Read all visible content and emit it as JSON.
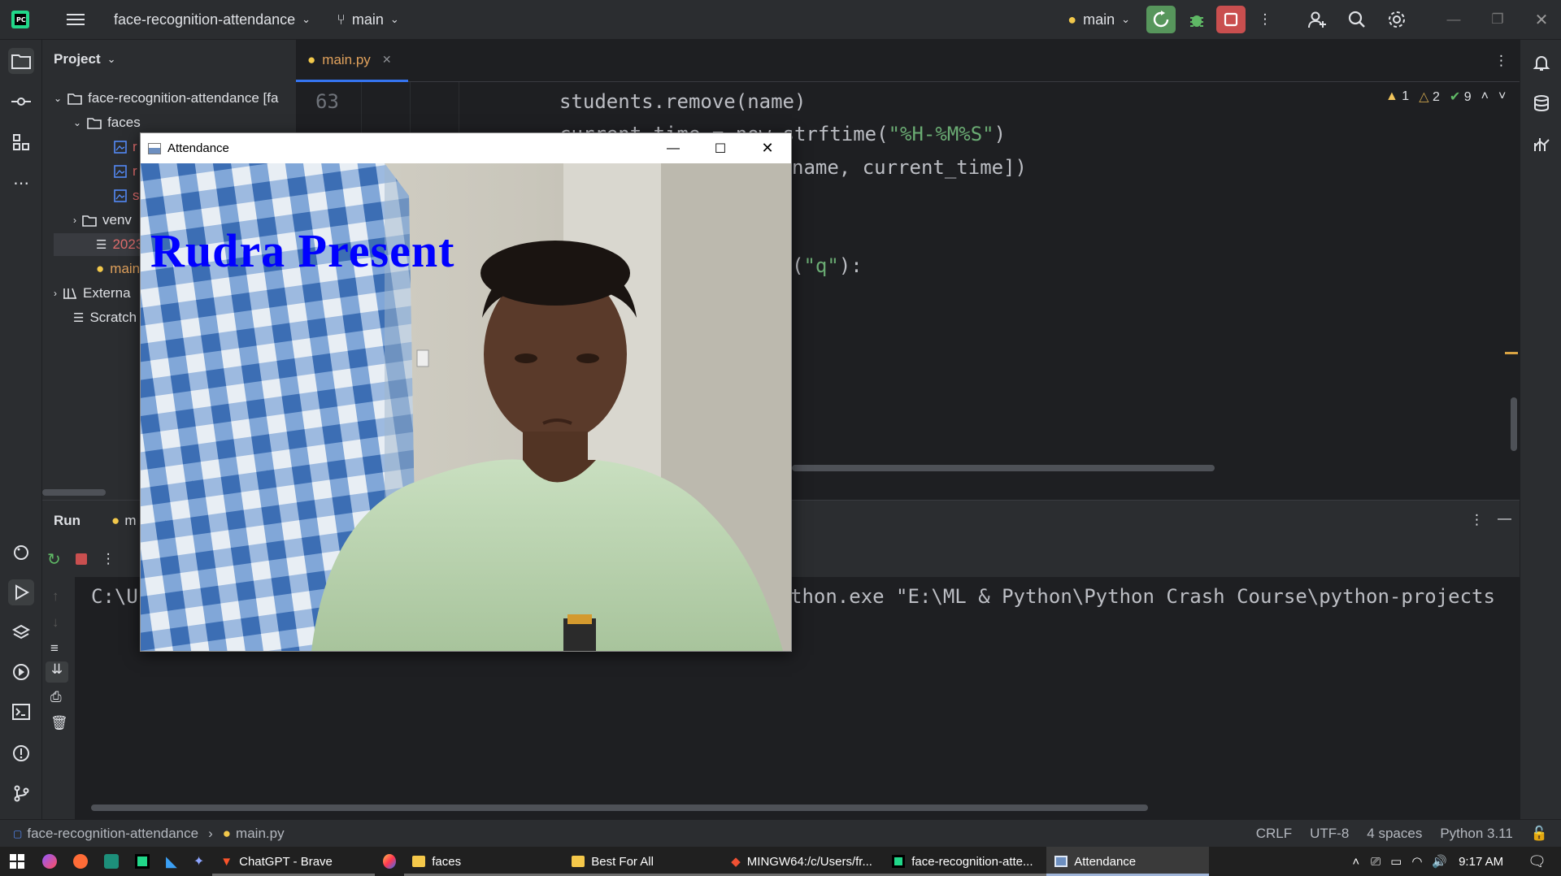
{
  "titlebar": {
    "project_name": "face-recognition-attendance",
    "branch": "main",
    "run_config": "main"
  },
  "project_panel": {
    "title": "Project",
    "tree": [
      {
        "label": "face-recognition-attendance [fa",
        "depth": 0
      },
      {
        "label": "faces",
        "depth": 1
      },
      {
        "label": "r",
        "depth": 2
      },
      {
        "label": "r",
        "depth": 2
      },
      {
        "label": "s",
        "depth": 2
      },
      {
        "label": "venv",
        "depth": 1
      },
      {
        "label": "2023",
        "depth": 1
      },
      {
        "label": "main",
        "depth": 1
      },
      {
        "label": "Externa",
        "depth": 0
      },
      {
        "label": "Scratch",
        "depth": 0
      }
    ]
  },
  "editor": {
    "tab_label": "main.py",
    "line_number": "63",
    "inspections": {
      "warnings": "1",
      "weak_warnings": "2",
      "typos": "9"
    },
    "lines": [
      {
        "text": "students.remove(name)"
      },
      {
        "pre": "current_time = now.strftime(",
        "str": "\"%H-%M%S\"",
        "post": ")"
      },
      {
        "text": "name, current_time])"
      },
      {
        "pre": "(",
        "str": "\"q\"",
        "post": "):"
      }
    ]
  },
  "run_panel": {
    "tab_label": "Run",
    "config_label": "m",
    "output_left": "C:\\U",
    "output_right": "thon.exe \"E:\\ML & Python\\Python Crash Course\\python-projects"
  },
  "status_bar": {
    "breadcrumb_project": "face-recognition-attendance",
    "breadcrumb_file": "main.py",
    "line_sep": "CRLF",
    "encoding": "UTF-8",
    "indent": "4 spaces",
    "interpreter": "Python 3.11"
  },
  "attendance_window": {
    "title": "Attendance",
    "overlay_text": "Rudra Present"
  },
  "taskbar": {
    "items": [
      {
        "label": "ChatGPT - Brave",
        "icon": "brave-icon"
      },
      {
        "label": "faces",
        "icon": "folder-icon"
      },
      {
        "label": "Best For All",
        "icon": "folder-icon"
      },
      {
        "label": "MINGW64:/c/Users/fr...",
        "icon": "git-bash-icon"
      },
      {
        "label": "face-recognition-atte...",
        "icon": "pycharm-icon"
      },
      {
        "label": "Attendance",
        "icon": "window-icon"
      }
    ],
    "clock": "9:17 AM"
  },
  "colors": {
    "accent_green": "#57965c",
    "stop_red": "#c94f4f",
    "overlay_blue": "#0000ff"
  }
}
